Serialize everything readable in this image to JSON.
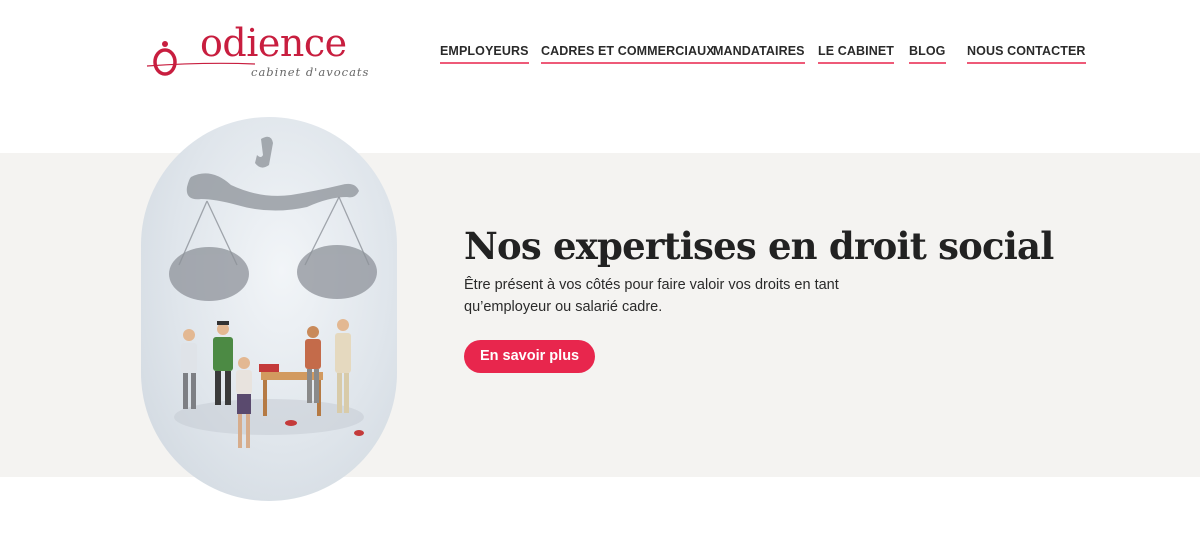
{
  "brand": {
    "name": "odience",
    "tagline": "cabinet d'avocats",
    "accent": "#c81e3f"
  },
  "nav": {
    "items": [
      {
        "label": "EMPLOYEURS"
      },
      {
        "label": "CADRES ET COMMERCIAUX"
      },
      {
        "label": "MANDATAIRES"
      },
      {
        "label": "LE CABINET"
      },
      {
        "label": "BLOG"
      },
      {
        "label": "NOUS CONTACTER"
      }
    ],
    "underline_color": "#ee5a78"
  },
  "hero": {
    "title": "Nos expertises en droit social",
    "text": "Être présent à vos côtés pour faire valoir vos droits en tant qu’employeur ou salarié cadre.",
    "cta_label": "En savoir plus",
    "cta_color": "#e8264d",
    "band_color": "#f4f3f1",
    "image_subject": "scales-of-justice-figurines-illustration"
  }
}
